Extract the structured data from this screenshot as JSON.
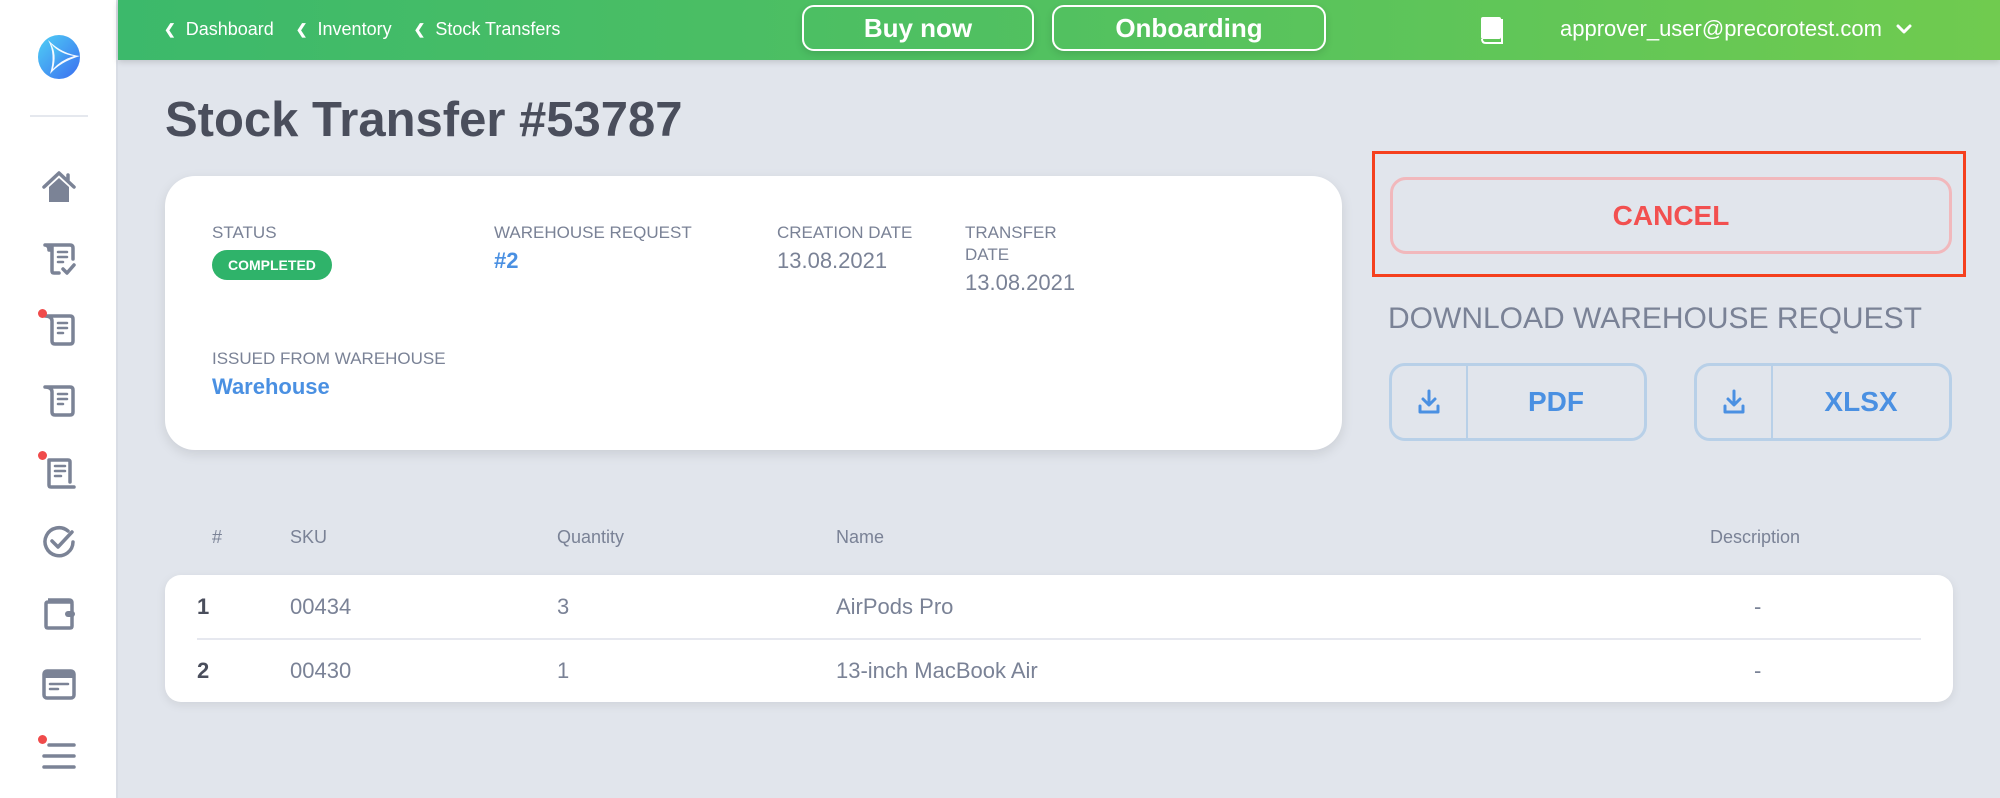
{
  "topbar": {
    "breadcrumbs": [
      "Dashboard",
      "Inventory",
      "Stock Transfers"
    ],
    "buy_now": "Buy now",
    "onboarding": "Onboarding",
    "user_email": "approver_user@precorotest.com"
  },
  "sidebar": {
    "items": [
      {
        "icon": "home-icon",
        "notify": false
      },
      {
        "icon": "document-check-icon",
        "notify": false
      },
      {
        "icon": "document-icon",
        "notify": true
      },
      {
        "icon": "document-icon",
        "notify": false
      },
      {
        "icon": "document-list-icon",
        "notify": true
      },
      {
        "icon": "check-circle-icon",
        "notify": false
      },
      {
        "icon": "wallet-icon",
        "notify": false
      },
      {
        "icon": "card-icon",
        "notify": false
      },
      {
        "icon": "menu-icon",
        "notify": true
      }
    ]
  },
  "page": {
    "title": "Stock Transfer #53787"
  },
  "info": {
    "status_label": "STATUS",
    "status_value": "COMPLETED",
    "status_color": "#2fb36a",
    "warehouse_request_label": "WAREHOUSE REQUEST",
    "warehouse_request_value": "#2",
    "creation_date_label": "CREATION DATE",
    "creation_date_value": "13.08.2021",
    "transfer_date_label_1": "TRANSFER",
    "transfer_date_label_2": "DATE",
    "transfer_date_value": "13.08.2021",
    "issued_from_label": "ISSUED FROM WAREHOUSE",
    "issued_from_value": "Warehouse"
  },
  "actions": {
    "cancel": "CANCEL",
    "download_title": "DOWNLOAD WAREHOUSE REQUEST",
    "pdf": "PDF",
    "xlsx": "XLSX"
  },
  "table": {
    "headers": {
      "num": "#",
      "sku": "SKU",
      "quantity": "Quantity",
      "name": "Name",
      "description": "Description"
    },
    "rows": [
      {
        "num": "1",
        "sku": "00434",
        "quantity": "3",
        "name": "AirPods Pro",
        "description": "-"
      },
      {
        "num": "2",
        "sku": "00430",
        "quantity": "1",
        "name": "13-inch MacBook Air",
        "description": "-"
      }
    ]
  }
}
